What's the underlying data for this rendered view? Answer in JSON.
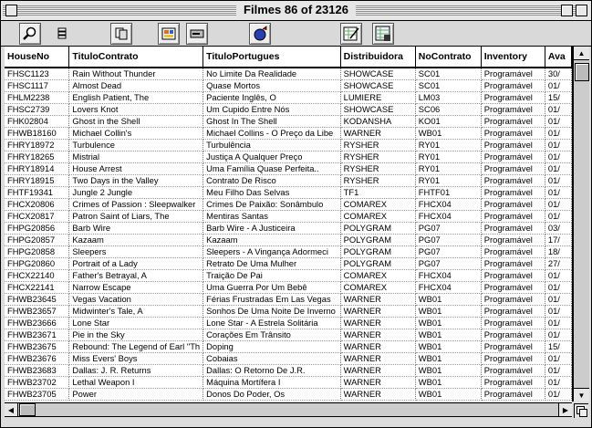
{
  "window": {
    "title": "Filmes 86 of 23126"
  },
  "toolbar": {
    "buttons": [
      "find-icon",
      "sort-icon",
      "copy-records-icon",
      "layout-icon",
      "drive-icon",
      "script-icon",
      "edit-sheet-icon",
      "sheet-options-icon"
    ]
  },
  "table": {
    "columns": [
      "HouseNo",
      "TituloContrato",
      "TituloPortugues",
      "Distribuidora",
      "NoContrato",
      "Inventory",
      "Ava"
    ],
    "rows": [
      [
        "FHSC1123",
        "Rain Without Thunder",
        "No Limite Da Realidade",
        "SHOWCASE",
        "SC01",
        "Programável",
        "30/"
      ],
      [
        "FHSC1117",
        "Almost Dead",
        "Quase Mortos",
        "SHOWCASE",
        "SC01",
        "Programável",
        "01/"
      ],
      [
        "FHLM2238",
        "English Patient, The",
        "Paciente Inglês, O",
        "LUMIERE",
        "LM03",
        "Programável",
        "15/"
      ],
      [
        "FHSC2739",
        "Lovers Knot",
        "Um Cupido Entre Nós",
        "SHOWCASE",
        "SC06",
        "Programável",
        "01/"
      ],
      [
        "FHK02804",
        "Ghost in the Shell",
        "Ghost In The Shell",
        "KODANSHA",
        "KO01",
        "Programável",
        "01/"
      ],
      [
        "FHWB18160",
        "Michael Collin's",
        "Michael Collins - O Preço da Libe",
        "WARNER",
        "WB01",
        "Programável",
        "01/"
      ],
      [
        "FHRY18972",
        "Turbulence",
        "Turbulência",
        "RYSHER",
        "RY01",
        "Programável",
        "01/"
      ],
      [
        "FHRY18265",
        "Mistrial",
        "Justiça A Qualquer Preço",
        "RYSHER",
        "RY01",
        "Programável",
        "01/"
      ],
      [
        "FHRY18914",
        "House Arrest",
        "Uma Família Quase Perfeita..",
        "RYSHER",
        "RY01",
        "Programável",
        "01/"
      ],
      [
        "FHRY18915",
        "Two Days in the Valley",
        "Contrato De Risco",
        "RYSHER",
        "RY01",
        "Programável",
        "01/"
      ],
      [
        "FHTF19341",
        "Jungle 2 Jungle",
        "Meu Filho Das Selvas",
        "TF1",
        "FHTF01",
        "Programável",
        "01/"
      ],
      [
        "FHCX20806",
        "Crimes of Passion : Sleepwalker",
        "Crimes De Paixão: Sonâmbulo",
        "COMAREX",
        "FHCX04",
        "Programável",
        "01/"
      ],
      [
        "FHCX20817",
        "Patron Saint of Liars, The",
        "Mentiras Santas",
        "COMAREX",
        "FHCX04",
        "Programável",
        "01/"
      ],
      [
        "FHPG20856",
        "Barb Wire",
        "Barb Wire - A Justiceira",
        "POLYGRAM",
        "PG07",
        "Programável",
        "03/"
      ],
      [
        "FHPG20857",
        "Kazaam",
        "Kazaam",
        "POLYGRAM",
        "PG07",
        "Programável",
        "17/"
      ],
      [
        "FHPG20858",
        "Sleepers",
        "Sleepers - A Vingança Adormeci",
        "POLYGRAM",
        "PG07",
        "Programável",
        "18/"
      ],
      [
        "FHPG20860",
        "Portrait of a Lady",
        "Retrato De Uma Mulher",
        "POLYGRAM",
        "PG07",
        "Programável",
        "27/"
      ],
      [
        "FHCX22140",
        "Father's Betrayal, A",
        "Traição De Pai",
        "COMAREX",
        "FHCX04",
        "Programável",
        "01/"
      ],
      [
        "FHCX22141",
        "Narrow Escape",
        "Uma Guerra Por Um Bebê",
        "COMAREX",
        "FHCX04",
        "Programável",
        "01/"
      ],
      [
        "FHWB23645",
        "Vegas Vacation",
        "Férias Frustradas Em Las Vegas",
        "WARNER",
        "WB01",
        "Programável",
        "01/"
      ],
      [
        "FHWB23657",
        "Midwinter's Tale, A",
        "Sonhos De Uma Noite De Inverno",
        "WARNER",
        "WB01",
        "Programável",
        "01/"
      ],
      [
        "FHWB23666",
        "Lone Star",
        "Lone Star - A Estrela Solitária",
        "WARNER",
        "WB01",
        "Programável",
        "01/"
      ],
      [
        "FHWB23671",
        "Pie in the Sky",
        "Corações Em Trânsito",
        "WARNER",
        "WB01",
        "Programável",
        "01/"
      ],
      [
        "FHWB23675",
        "Rebound: The Legend of Earl \"Th",
        "Doping",
        "WARNER",
        "WB01",
        "Programável",
        "15/"
      ],
      [
        "FHWB23676",
        "Miss Evers' Boys",
        "Cobaias",
        "WARNER",
        "WB01",
        "Programável",
        "01/"
      ],
      [
        "FHWB23683",
        "Dallas: J. R. Returns",
        "Dallas: O Retorno De J.R.",
        "WARNER",
        "WB01",
        "Programável",
        "01/"
      ],
      [
        "FHWB23702",
        "Lethal Weapon I",
        "Máquina Mortífera I",
        "WARNER",
        "WB01",
        "Programável",
        "01/"
      ],
      [
        "FHWB23705",
        "Power",
        "Donos Do Poder, Os",
        "WARNER",
        "WB01",
        "Programável",
        "01/"
      ]
    ]
  }
}
